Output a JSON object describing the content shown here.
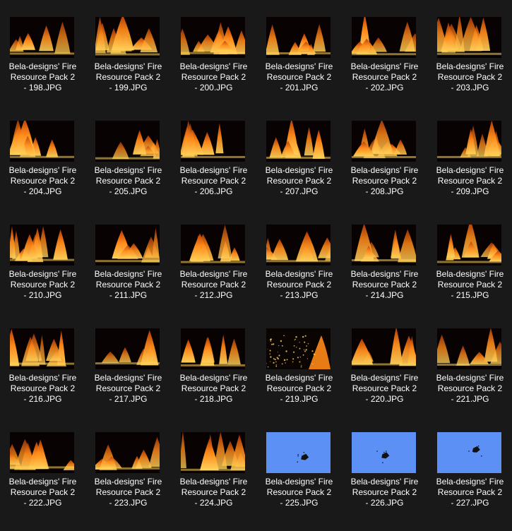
{
  "explorer": {
    "files": [
      {
        "name": "Bela-designs' Fire\nResource Pack 2\n- 198.JPG",
        "thumb": "fire"
      },
      {
        "name": "Bela-designs' Fire\nResource Pack 2\n- 199.JPG",
        "thumb": "fire"
      },
      {
        "name": "Bela-designs' Fire\nResource Pack 2\n- 200.JPG",
        "thumb": "fire"
      },
      {
        "name": "Bela-designs' Fire\nResource Pack 2\n- 201.JPG",
        "thumb": "fire"
      },
      {
        "name": "Bela-designs' Fire\nResource Pack 2\n- 202.JPG",
        "thumb": "fire"
      },
      {
        "name": "Bela-designs' Fire\nResource Pack 2\n- 203.JPG",
        "thumb": "fire"
      },
      {
        "name": "Bela-designs' Fire\nResource Pack 2\n- 204.JPG",
        "thumb": "fire"
      },
      {
        "name": "Bela-designs' Fire\nResource Pack 2\n- 205.JPG",
        "thumb": "fire"
      },
      {
        "name": "Bela-designs' Fire\nResource Pack 2\n- 206.JPG",
        "thumb": "fire"
      },
      {
        "name": "Bela-designs' Fire\nResource Pack 2\n- 207.JPG",
        "thumb": "fire"
      },
      {
        "name": "Bela-designs' Fire\nResource Pack 2\n- 208.JPG",
        "thumb": "fire"
      },
      {
        "name": "Bela-designs' Fire\nResource Pack 2\n- 209.JPG",
        "thumb": "fire"
      },
      {
        "name": "Bela-designs' Fire\nResource Pack 2\n- 210.JPG",
        "thumb": "fire"
      },
      {
        "name": "Bela-designs' Fire\nResource Pack 2\n- 211.JPG",
        "thumb": "fire"
      },
      {
        "name": "Bela-designs' Fire\nResource Pack 2\n- 212.JPG",
        "thumb": "fire"
      },
      {
        "name": "Bela-designs' Fire\nResource Pack 2\n- 213.JPG",
        "thumb": "fire"
      },
      {
        "name": "Bela-designs' Fire\nResource Pack 2\n- 214.JPG",
        "thumb": "fire"
      },
      {
        "name": "Bela-designs' Fire\nResource Pack 2\n- 215.JPG",
        "thumb": "fire"
      },
      {
        "name": "Bela-designs' Fire\nResource Pack 2\n- 216.JPG",
        "thumb": "fire"
      },
      {
        "name": "Bela-designs' Fire\nResource Pack 2\n- 217.JPG",
        "thumb": "fire"
      },
      {
        "name": "Bela-designs' Fire\nResource Pack 2\n- 218.JPG",
        "thumb": "fire"
      },
      {
        "name": "Bela-designs' Fire\nResource Pack 2\n- 219.JPG",
        "thumb": "sparks"
      },
      {
        "name": "Bela-designs' Fire\nResource Pack 2\n- 220.JPG",
        "thumb": "fire"
      },
      {
        "name": "Bela-designs' Fire\nResource Pack 2\n- 221.JPG",
        "thumb": "fire"
      },
      {
        "name": "Bela-designs' Fire\nResource Pack 2\n- 222.JPG",
        "thumb": "fire"
      },
      {
        "name": "Bela-designs' Fire\nResource Pack 2\n- 223.JPG",
        "thumb": "fire"
      },
      {
        "name": "Bela-designs' Fire\nResource Pack 2\n- 224.JPG",
        "thumb": "fire"
      },
      {
        "name": "Bela-designs' Fire\nResource Pack 2\n- 225.JPG",
        "thumb": "blue-sky"
      },
      {
        "name": "Bela-designs' Fire\nResource Pack 2\n- 226.JPG",
        "thumb": "blue-sky"
      },
      {
        "name": "Bela-designs' Fire\nResource Pack 2\n- 227.JPG",
        "thumb": "blue-sky"
      }
    ]
  },
  "colors": {
    "background": "#191919",
    "label_text": "#ffffff",
    "fire_bright": "#ffd25a",
    "fire_mid": "#ff8a1a",
    "fire_dark": "#b83a06",
    "sky_blue": "#5c90f5"
  }
}
